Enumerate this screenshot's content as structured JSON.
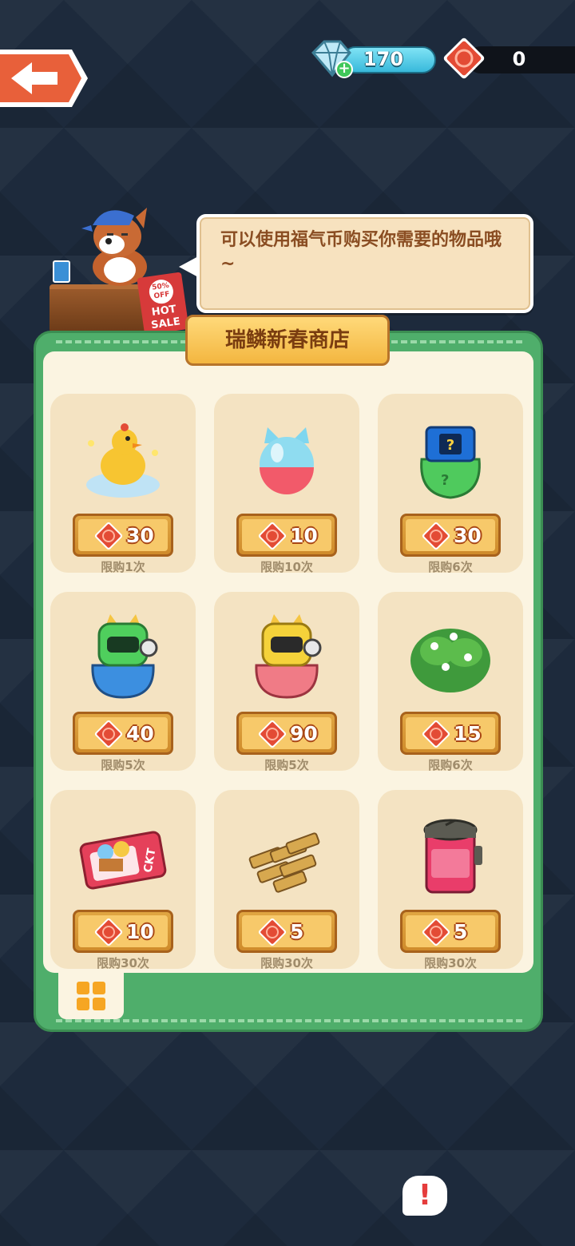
{
  "header": {
    "gem_count": "170",
    "coin_count": "0",
    "plus_label": "+"
  },
  "shopkeeper": {
    "sale_badge": "50% OFF",
    "sale_text": "HOT SALE",
    "speech": "可以使用福气币购买你需要的物品哦~"
  },
  "shop": {
    "title": "瑞鳞新春商店",
    "items": [
      {
        "name": "duck-cloud-item",
        "price": "30",
        "limit": "限购1次",
        "art": "duck"
      },
      {
        "name": "cat-crystal-orb-item",
        "price": "10",
        "limit": "限购10次",
        "art": "orb"
      },
      {
        "name": "green-mystery-bag-item",
        "price": "30",
        "limit": "限购6次",
        "art": "bag"
      },
      {
        "name": "blue-robot-bag-item",
        "price": "40",
        "limit": "限购5次",
        "art": "robotblue"
      },
      {
        "name": "pink-robot-bag-item",
        "price": "90",
        "limit": "限购5次",
        "art": "robotpink"
      },
      {
        "name": "flower-bush-item",
        "price": "15",
        "limit": "限购6次",
        "art": "bush"
      },
      {
        "name": "ticket-item",
        "price": "10",
        "limit": "限购30次",
        "art": "ticket"
      },
      {
        "name": "wood-logs-item",
        "price": "5",
        "limit": "限购30次",
        "art": "wood"
      },
      {
        "name": "jam-jar-item",
        "price": "5",
        "limit": "限购30次",
        "art": "jar"
      }
    ],
    "ticket_text": "CKT"
  },
  "colors": {
    "panel_green": "#4fae6b",
    "card_bg": "#f4e3c2",
    "price_gold": "#e0a642",
    "back_red": "#e8603a"
  }
}
